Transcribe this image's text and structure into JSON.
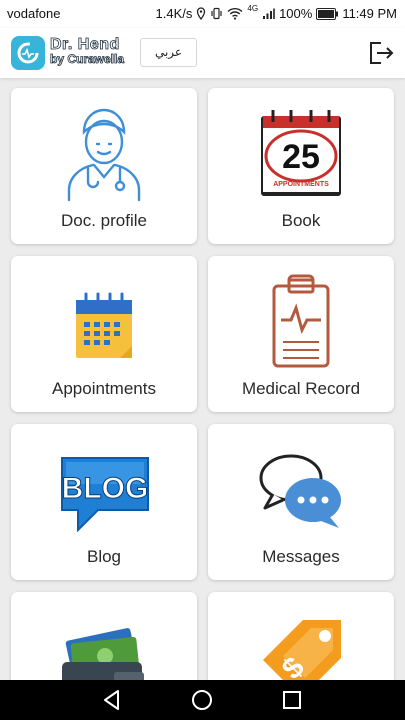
{
  "status": {
    "carrier": "vodafone",
    "speed": "1.4K/s",
    "network": "4G",
    "battery": "100%",
    "time": "11:49 PM"
  },
  "header": {
    "brand_line1": "Dr. Hend",
    "brand_line2": "by Curawella",
    "language_button": "عربي",
    "logout_icon": "logout-icon",
    "accent_color": "#37b4d8"
  },
  "menu": [
    {
      "label": "Doc. profile",
      "icon": "doctor-icon"
    },
    {
      "label": "Book",
      "icon": "calendar-day-icon",
      "icon_text_number": "25",
      "icon_text_caption": "APPOINTMENTS"
    },
    {
      "label": "Appointments",
      "icon": "calendar-icon"
    },
    {
      "label": "Medical Record",
      "icon": "clipboard-icon"
    },
    {
      "label": "Blog",
      "icon": "blog-icon",
      "icon_text": "BLOG"
    },
    {
      "label": "Messages",
      "icon": "chat-bubbles-icon"
    },
    {
      "label": "",
      "icon": "wallet-icon"
    },
    {
      "label": "",
      "icon": "price-tag-icon"
    }
  ],
  "navigation": [
    "back-icon",
    "home-icon",
    "recents-icon"
  ]
}
